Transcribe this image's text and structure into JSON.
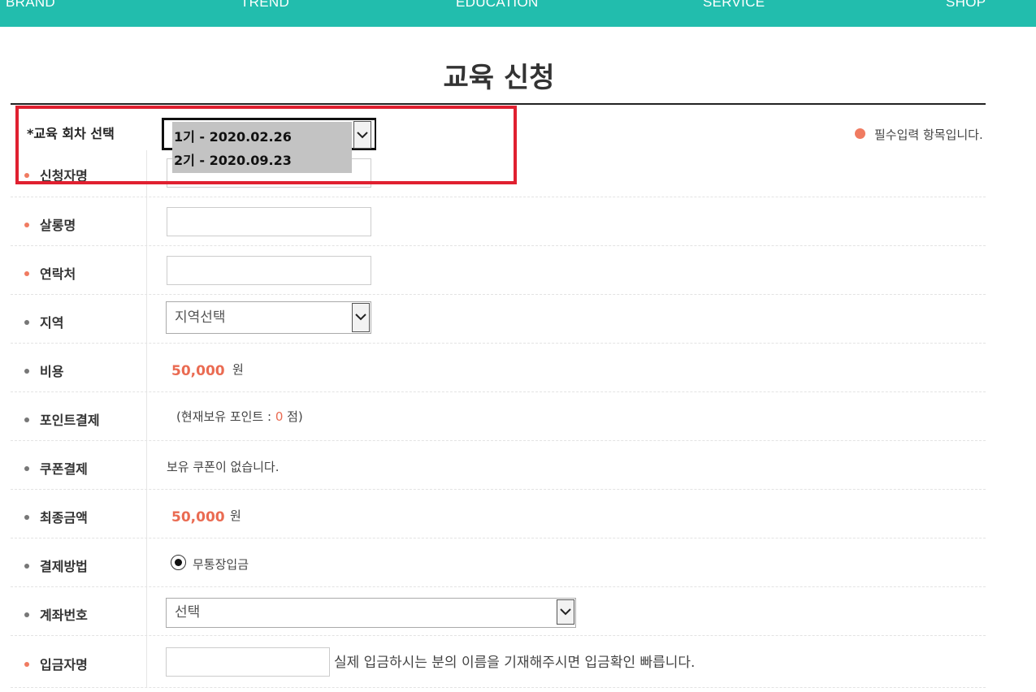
{
  "nav": {
    "items": [
      "BRAND",
      "TREND",
      "EDUCATION",
      "SERVICE",
      "SHOP"
    ],
    "color": "#22bdad"
  },
  "page": {
    "title": "교육 신청"
  },
  "form": {
    "required_note": "필수입력 항목입니다.",
    "session": {
      "label": "*교육 회차 선택",
      "options": [
        "1기 - 2020.02.26",
        "2기 - 2020.09.23"
      ]
    },
    "rows": {
      "applicant": {
        "label": "신청자명",
        "value": ""
      },
      "salon": {
        "label": "살롱명",
        "value": ""
      },
      "contact": {
        "label": "연락처",
        "value": ""
      },
      "region": {
        "label": "지역",
        "selected": "지역선택"
      },
      "fee": {
        "label": "비용",
        "amount": "50,000",
        "unit": "원"
      },
      "point": {
        "label": "포인트결제",
        "prefix": "(현재보유 포인트 : ",
        "points": "0",
        "suffix": " 점)"
      },
      "coupon": {
        "label": "쿠폰결제",
        "text": "보유 쿠폰이 없습니다."
      },
      "total": {
        "label": "최종금액",
        "amount": "50,000",
        "unit": "원"
      },
      "payment": {
        "label": "결제방법",
        "option": "무통장입금"
      },
      "account": {
        "label": "계좌번호",
        "selected": "선택"
      },
      "depositor": {
        "label": "입금자명",
        "value": "",
        "hint": "실제 입금하시는 분의 이름을 기재해주시면 입금확인 빠릅니다."
      }
    }
  },
  "colors": {
    "accent": "#ea6b52",
    "required_dot": "#f07b61",
    "highlight": "#e02030"
  }
}
